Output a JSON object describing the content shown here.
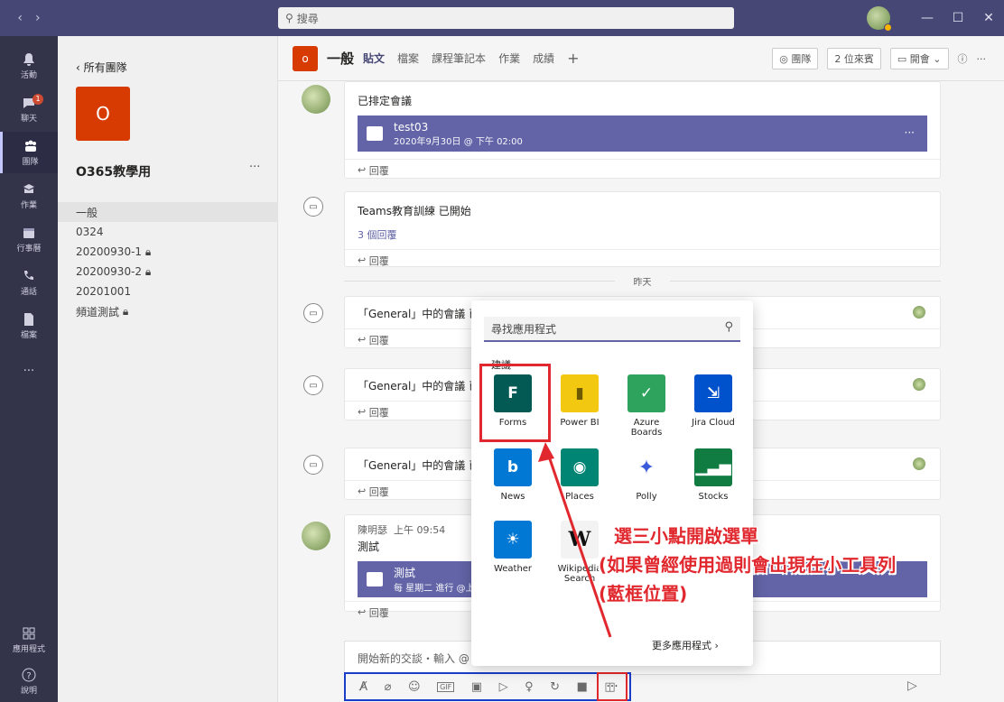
{
  "topbar": {
    "back_icon": "chevron-left-icon",
    "forward_icon": "chevron-right-icon",
    "search_placeholder": "搜尋",
    "minimize": "—",
    "maximize": "☐",
    "close": "✕"
  },
  "rail": {
    "items": [
      {
        "label": "活動",
        "icon": "bell-icon"
      },
      {
        "label": "聊天",
        "icon": "chat-icon",
        "badge": "1"
      },
      {
        "label": "團隊",
        "icon": "teams-icon"
      },
      {
        "label": "作業",
        "icon": "assignment-icon"
      },
      {
        "label": "行事曆",
        "icon": "calendar-icon"
      },
      {
        "label": "通話",
        "icon": "phone-icon"
      },
      {
        "label": "檔案",
        "icon": "file-icon"
      }
    ],
    "more": "···",
    "apps_label": "應用程式",
    "help_label": "說明"
  },
  "team": {
    "back_label": "所有團隊",
    "tile_letter": "O",
    "name": "O365教學用",
    "more": "···",
    "channels": [
      {
        "name": "一般",
        "selected": true,
        "private": false
      },
      {
        "name": "0324",
        "selected": false,
        "private": false
      },
      {
        "name": "20200930-1",
        "selected": false,
        "private": true
      },
      {
        "name": "20200930-2",
        "selected": false,
        "private": true
      },
      {
        "name": "20201001",
        "selected": false,
        "private": false
      },
      {
        "name": "頻道測試",
        "selected": false,
        "private": true
      }
    ]
  },
  "header": {
    "tile_letter": "o",
    "title": "一般",
    "tabs": [
      "貼文",
      "檔案",
      "課程筆記本",
      "作業",
      "成績"
    ],
    "add_tab": "+",
    "team_btn": "◎ 團隊",
    "guests": "2 位來賓",
    "meet_btn": "開會",
    "info": "ⓘ",
    "more": "···"
  },
  "posts": {
    "p1": {
      "subtitle": "已排定會議",
      "card_title": "test03",
      "card_time": "2020年9月30日 @ 下午 02:00",
      "reply": "回覆"
    },
    "p2": {
      "text": "Teams教育訓練 已開始",
      "replies": "3 個回覆",
      "reply": "回覆"
    },
    "date_divider": "昨天",
    "p3": {
      "text": "「General」中的會議 已",
      "reply": "回覆"
    },
    "p4": {
      "text": "「General」中的會議 已",
      "reply": "回覆"
    },
    "p5": {
      "text": "「General」中的會議 已",
      "reply": "回覆"
    },
    "p6": {
      "author": "陳明瑟",
      "time": "上午 09:54",
      "text": "測試",
      "card_title": "測試",
      "card_sub": "每 星期二 進行 @上",
      "reply": "回覆"
    }
  },
  "compose": {
    "placeholder": "開始新的交談・輸入 @",
    "toolbar_icons": [
      "format-icon",
      "attach-icon",
      "emoji-icon",
      "gif-icon",
      "sticker-icon",
      "meet-now-icon",
      "praise-icon",
      "loop-icon",
      "stream-icon",
      "forms-icon"
    ],
    "toolbar_glyphs": [
      "A̸",
      "⌀",
      "☺",
      "GIF",
      "▣",
      "▷",
      "♀",
      "↻",
      "■",
      "◫"
    ],
    "more": "···",
    "send": "▷"
  },
  "flyout": {
    "search_placeholder": "尋找應用程式",
    "section": "建議",
    "apps": [
      {
        "name": "Forms",
        "color": "#035a55",
        "glyph": "F"
      },
      {
        "name": "Power BI",
        "color": "#f2c811",
        "glyph": "▮"
      },
      {
        "name": "Azure Boards",
        "color": "#ffffff",
        "glyph": "✓"
      },
      {
        "name": "Jira Cloud",
        "color": "#0052cc",
        "glyph": "⇲"
      },
      {
        "name": "News",
        "color": "#0078d4",
        "glyph": "b"
      },
      {
        "name": "Places",
        "color": "#008575",
        "glyph": "◉"
      },
      {
        "name": "Polly",
        "color": "#ffffff",
        "glyph": "✦"
      },
      {
        "name": "Stocks",
        "color": "#107c41",
        "glyph": "📈"
      },
      {
        "name": "Weather",
        "color": "#0078d4",
        "glyph": "☀"
      },
      {
        "name": "Wikipedia Search",
        "color": "#f3f3f3",
        "glyph": "W"
      }
    ],
    "more_apps": "更多應用程式 ›"
  },
  "annotation": {
    "line1": "選三小點開啟選單",
    "line2": "(如果曾經使用過則會出現在小工具列",
    "line3": "(藍框位置)"
  }
}
